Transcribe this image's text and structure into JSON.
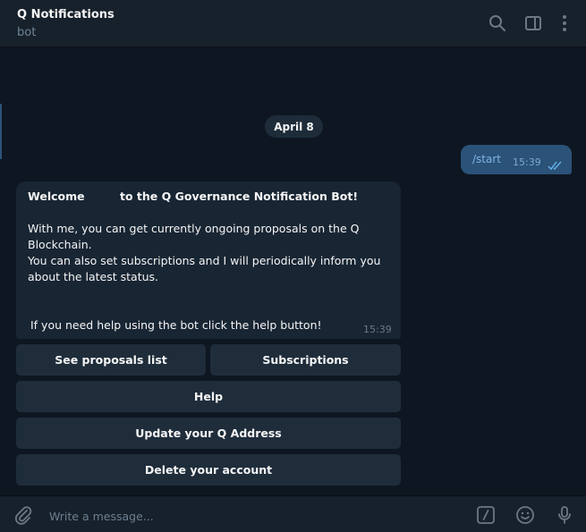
{
  "header": {
    "title": "Q Notifications",
    "subtitle": "bot",
    "icons": [
      "search-icon",
      "sidebar-toggle-icon",
      "more-vertical-icon"
    ]
  },
  "chat": {
    "date_label": "April 8",
    "outgoing": {
      "text": "/start",
      "time": "15:39",
      "status": "read"
    },
    "incoming": {
      "lines": [
        "Welcome",
        "to the Q Governance Notification Bot!",
        "With me, you can get currently ongoing proposals on the Q",
        "Blockchain.",
        "You can also set subscriptions and I will periodically inform you",
        "about the latest status.",
        "If you need help using the bot click the help button!"
      ],
      "time": "15:39"
    },
    "keyboard": {
      "see_proposals": "See proposals list",
      "subscriptions": "Subscriptions",
      "help": "Help",
      "update_address": "Update your Q Address",
      "delete_account": "Delete your account"
    }
  },
  "composer": {
    "placeholder": "Write a message...",
    "icons": [
      "attach-icon",
      "bot-commands-icon",
      "emoji-icon",
      "microphone-icon"
    ]
  },
  "colors": {
    "background": "#0e1621",
    "header": "#17212b",
    "outgoing_bubble": "#2b5278",
    "incoming_bubble": "#182533",
    "button": "#1f2d3b",
    "icon": "#6c7883",
    "accent": "#64b5ef"
  }
}
